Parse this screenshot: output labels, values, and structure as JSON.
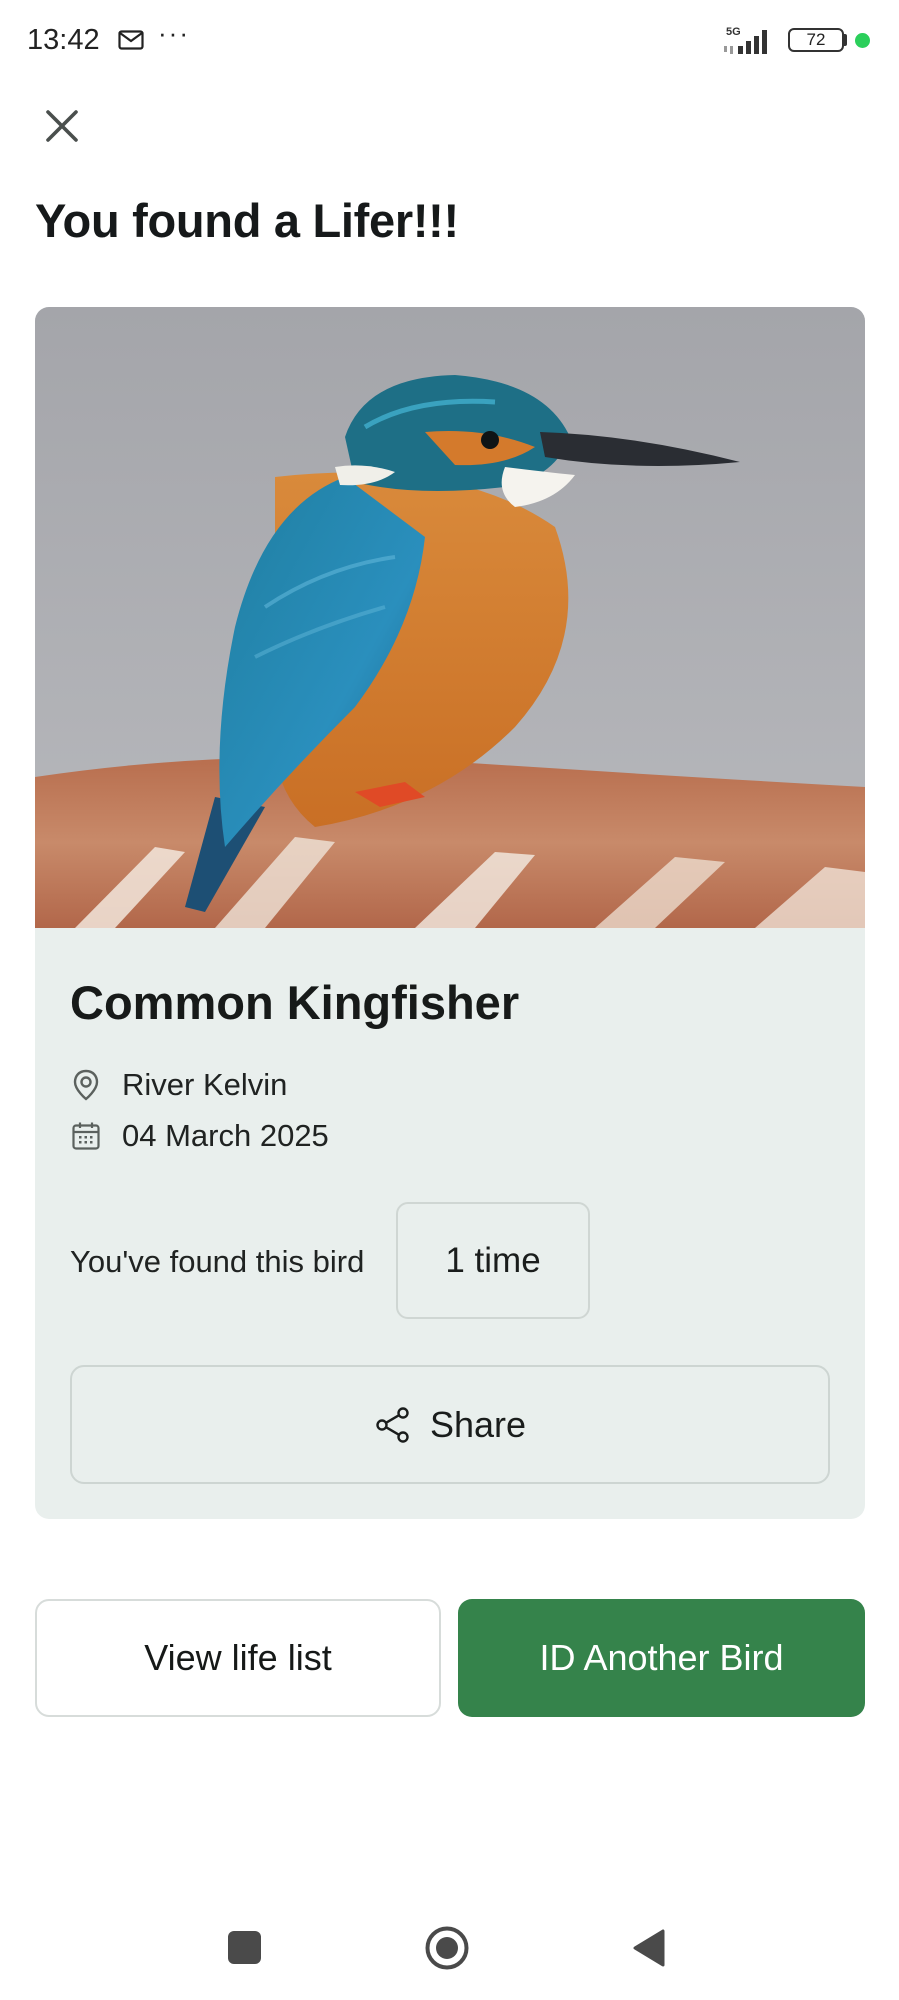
{
  "status_bar": {
    "time": "13:42",
    "more": "···",
    "network": "5G",
    "battery": "72",
    "icons": [
      "mail-icon",
      "more-dots-icon",
      "signal-5g-icon",
      "battery-icon",
      "green-dot-indicator"
    ]
  },
  "header": {
    "close_icon": "close-icon",
    "title": "You found a Lifer!!!"
  },
  "card": {
    "photo_alt": "Common Kingfisher photo",
    "bird_name": "Common Kingfisher",
    "location": "River Kelvin",
    "date": "04 March 2025",
    "found_label": "You've found this bird",
    "found_count": "1 time",
    "share_label": "Share",
    "icons": [
      "location-pin-icon",
      "calendar-icon",
      "share-icon"
    ]
  },
  "actions": {
    "view_life_list": "View life list",
    "id_another": "ID Another Bird"
  },
  "colors": {
    "primary_green": "#35834b",
    "card_bg": "#e9efed",
    "status_dot": "#2bcf5b"
  },
  "nav": {
    "icons": [
      "recents-square-icon",
      "home-circle-icon",
      "back-triangle-icon"
    ]
  }
}
